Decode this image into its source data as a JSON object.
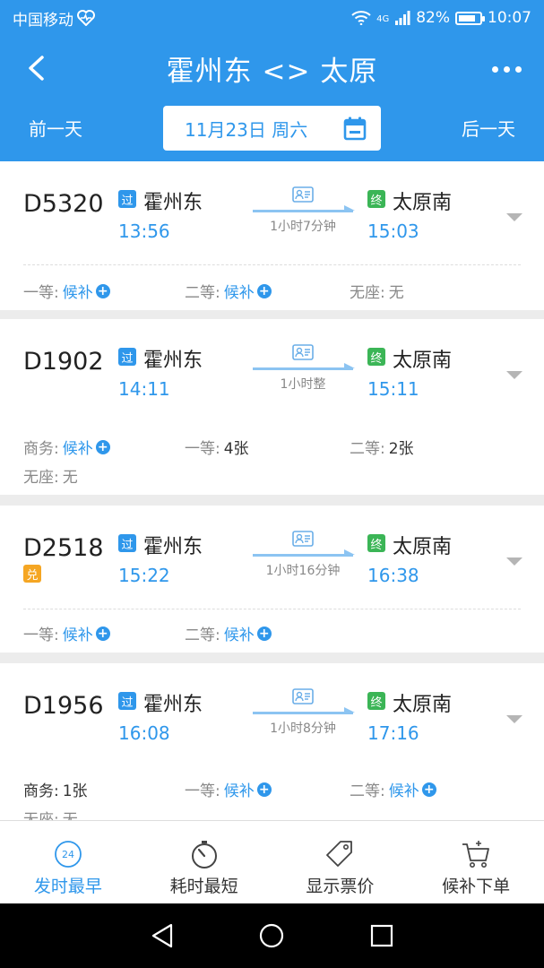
{
  "status_bar": {
    "carrier": "中国移动",
    "network": "4G",
    "battery": "82%",
    "time": "10:07"
  },
  "header": {
    "title": "霍州东 <> 太原",
    "prev_day": "前一天",
    "next_day": "后一天",
    "date": "11月23日 周六"
  },
  "trains": [
    {
      "number": "D5320",
      "from_tag": "过",
      "from": "霍州东",
      "depart": "13:56",
      "duration": "1小时7分钟",
      "to_tag": "终",
      "to": "太原南",
      "arrive": "15:03",
      "seats": [
        {
          "label": "一等:",
          "value": "候补",
          "waitlist": true
        },
        {
          "label": "二等:",
          "value": "候补",
          "waitlist": true
        },
        {
          "label": "无座:",
          "value": "无",
          "waitlist": false
        }
      ]
    },
    {
      "number": "D1902",
      "from_tag": "过",
      "from": "霍州东",
      "depart": "14:11",
      "duration": "1小时整",
      "to_tag": "终",
      "to": "太原南",
      "arrive": "15:11",
      "seats": [
        {
          "label": "商务:",
          "value": "候补",
          "waitlist": true
        },
        {
          "label": "一等:",
          "value": "4张",
          "waitlist": false
        },
        {
          "label": "二等:",
          "value": "2张",
          "waitlist": false
        },
        {
          "label": "无座:",
          "value": "无",
          "waitlist": false
        }
      ]
    },
    {
      "number": "D2518",
      "badge": "兑",
      "from_tag": "过",
      "from": "霍州东",
      "depart": "15:22",
      "duration": "1小时16分钟",
      "to_tag": "终",
      "to": "太原南",
      "arrive": "16:38",
      "seats": [
        {
          "label": "一等:",
          "value": "候补",
          "waitlist": true
        },
        {
          "label": "二等:",
          "value": "候补",
          "waitlist": true
        }
      ]
    },
    {
      "number": "D1956",
      "from_tag": "过",
      "from": "霍州东",
      "depart": "16:08",
      "duration": "1小时8分钟",
      "to_tag": "终",
      "to": "太原南",
      "arrive": "17:16",
      "seats": [
        {
          "label": "商务:",
          "value": "1张",
          "waitlist": false
        },
        {
          "label": "一等:",
          "value": "候补",
          "waitlist": true
        },
        {
          "label": "二等:",
          "value": "候补",
          "waitlist": true
        },
        {
          "label": "无座:",
          "value": "无",
          "waitlist": false
        }
      ]
    }
  ],
  "toolbar": {
    "items": [
      {
        "label": "发时最早",
        "icon": "clock-24-icon",
        "badge": "24",
        "active": true
      },
      {
        "label": "耗时最短",
        "icon": "stopwatch-icon",
        "active": false
      },
      {
        "label": "显示票价",
        "icon": "price-tag-icon",
        "active": false
      },
      {
        "label": "候补下单",
        "icon": "cart-add-icon",
        "active": false
      }
    ]
  },
  "colors": {
    "primary": "#2f97eb",
    "terminal_tag": "#3bb556",
    "exchange_badge": "#f5a623"
  }
}
